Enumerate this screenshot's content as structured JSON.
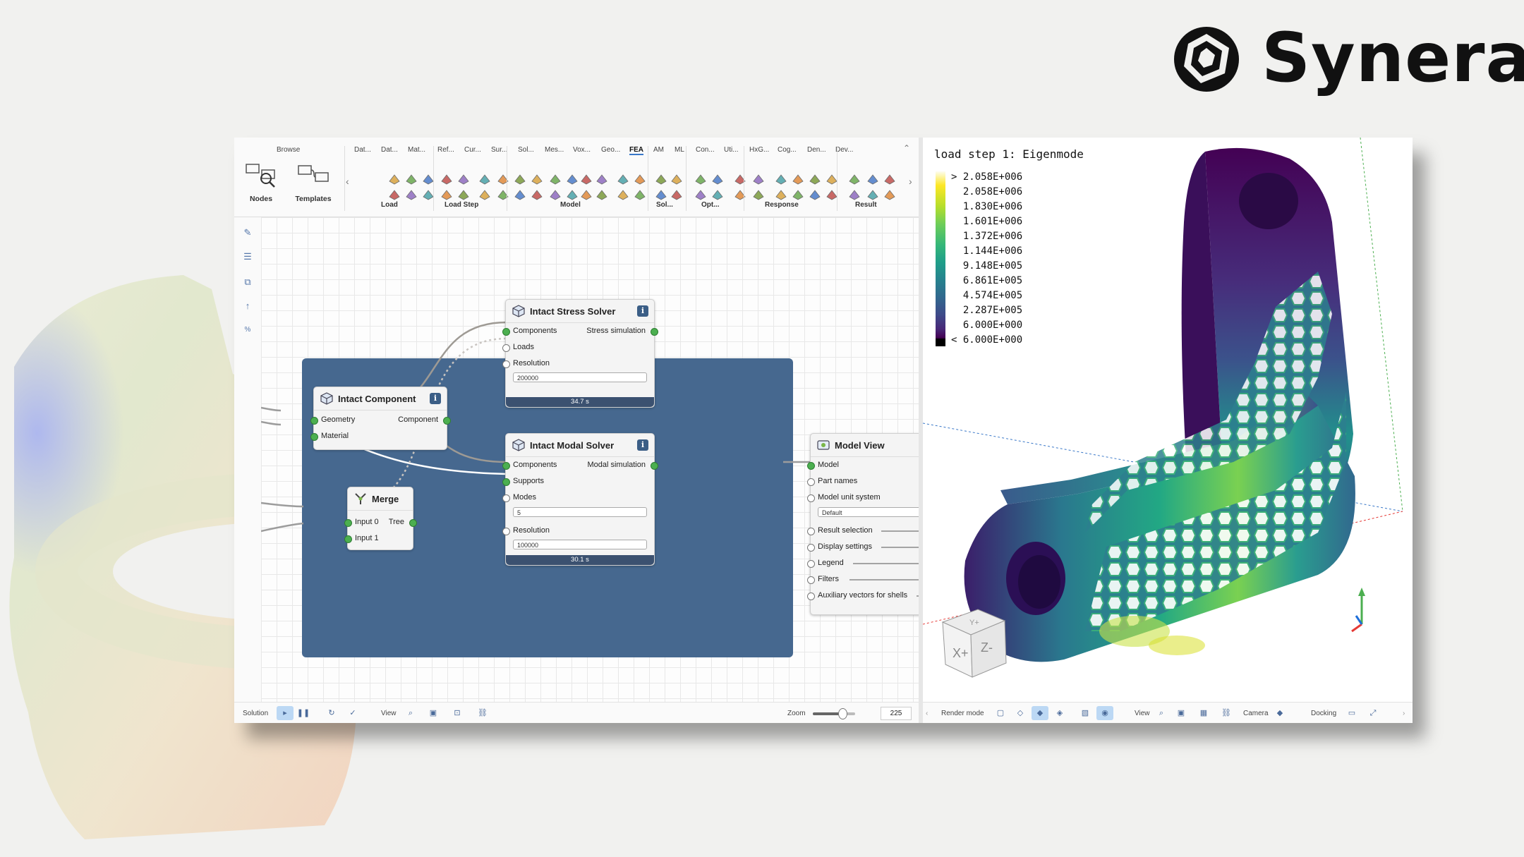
{
  "brand": {
    "name": "Synera"
  },
  "ribbon": {
    "browse": "Browse",
    "nodes": "Nodes",
    "templates": "Templates",
    "tabs": [
      "Dat...",
      "Dat...",
      "Mat...",
      "Ref...",
      "Cur...",
      "Sur...",
      "Sol...",
      "Mes...",
      "Vox...",
      "Geo...",
      "FEA",
      "AM",
      "ML",
      "Con...",
      "Uti...",
      "HxG...",
      "Cog...",
      "Den...",
      "Dev..."
    ],
    "active_tab": "FEA",
    "groups": [
      "Load",
      "Load Step",
      "Model",
      "Sol...",
      "Opt...",
      "Response",
      "Result"
    ]
  },
  "nodes": {
    "stress": {
      "title": "Intact Stress Solver",
      "in": [
        "Components",
        "Loads",
        "Resolution"
      ],
      "out": "Stress simulation",
      "resolution": "200000",
      "time": "34.7 s"
    },
    "component": {
      "title": "Intact Component",
      "in": [
        "Geometry",
        "Material"
      ],
      "out": "Component"
    },
    "modal": {
      "title": "Intact Modal Solver",
      "in": [
        "Components",
        "Supports",
        "Modes",
        "Resolution"
      ],
      "out": "Modal simulation",
      "modes": "5",
      "resolution": "100000",
      "time": "30.1 s"
    },
    "merge": {
      "title": "Merge",
      "in": [
        "Input 0",
        "Input 1"
      ],
      "out": "Tree"
    },
    "modelview": {
      "title": "Model View",
      "inputs": [
        "Model",
        "Part names",
        "Model unit system",
        "Result selection",
        "Display settings",
        "Legend",
        "Filters",
        "Auxiliary vectors for shells"
      ],
      "unit_default": "Default"
    }
  },
  "status_left": {
    "solution": "Solution",
    "view": "View",
    "zoom": "Zoom",
    "zoom_value": "225",
    "zoom_fraction": 0.7
  },
  "viewport": {
    "title": "load step 1: Eigenmode",
    "legend": [
      "> 2.058E+006",
      "  2.058E+006",
      "  1.830E+006",
      "  1.601E+006",
      "  1.372E+006",
      "  1.144E+006",
      "  9.148E+005",
      "  6.861E+005",
      "  4.574E+005",
      "  2.287E+005",
      "  6.000E+000",
      "< 6.000E+000"
    ],
    "cube_faces": [
      "X+",
      "Z-",
      "Y+"
    ],
    "status": {
      "render_mode": "Render mode",
      "view": "View",
      "camera": "Camera",
      "docking": "Docking"
    }
  },
  "colors": {
    "group": "#46688f",
    "port": "#4caf50",
    "accent": "#3a78c8"
  }
}
